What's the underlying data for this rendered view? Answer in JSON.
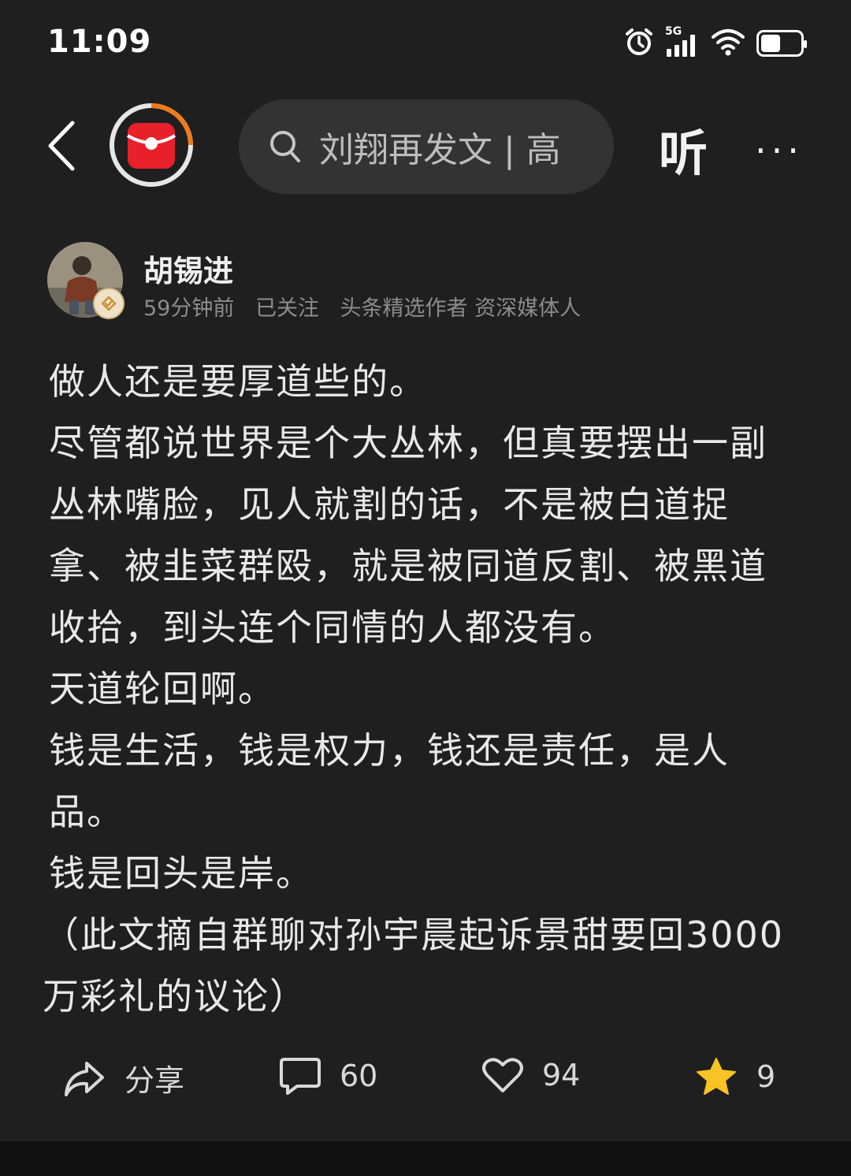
{
  "status_bar": {
    "time": "11:09",
    "network": "5G",
    "battery_percent": 50
  },
  "nav": {
    "search_placeholder": "刘翔再发文 | 高",
    "listen_label": "听",
    "more_label": "···"
  },
  "post": {
    "author": "胡锡进",
    "time_ago": "59分钟前",
    "follow_status": "已关注",
    "tags": "头条精选作者 资深媒体人",
    "paragraphs": [
      "做人还是要厚道些的。",
      "尽管都说世界是个大丛林，但真要摆出一副丛林嘴脸，见人就割的话，不是被白道捉拿、被韭菜群殴，就是被同道反割、被黑道收拾，到头连个同情的人都没有。",
      "天道轮回啊。",
      "钱是生活，钱是权力，钱还是责任，是人品。",
      "钱是回头是岸。",
      "（此文摘自群聊对孙宇晨起诉景甜要回3000万彩礼的议论）"
    ]
  },
  "actions": {
    "share_label": "分享",
    "comments": "60",
    "likes": "94",
    "favorites": "9"
  },
  "colors": {
    "background": "#1f1f1f",
    "search_bg": "#333333",
    "logo_red": "#e8202a",
    "logo_ring": "#f27a1a",
    "star": "#f7c325"
  }
}
